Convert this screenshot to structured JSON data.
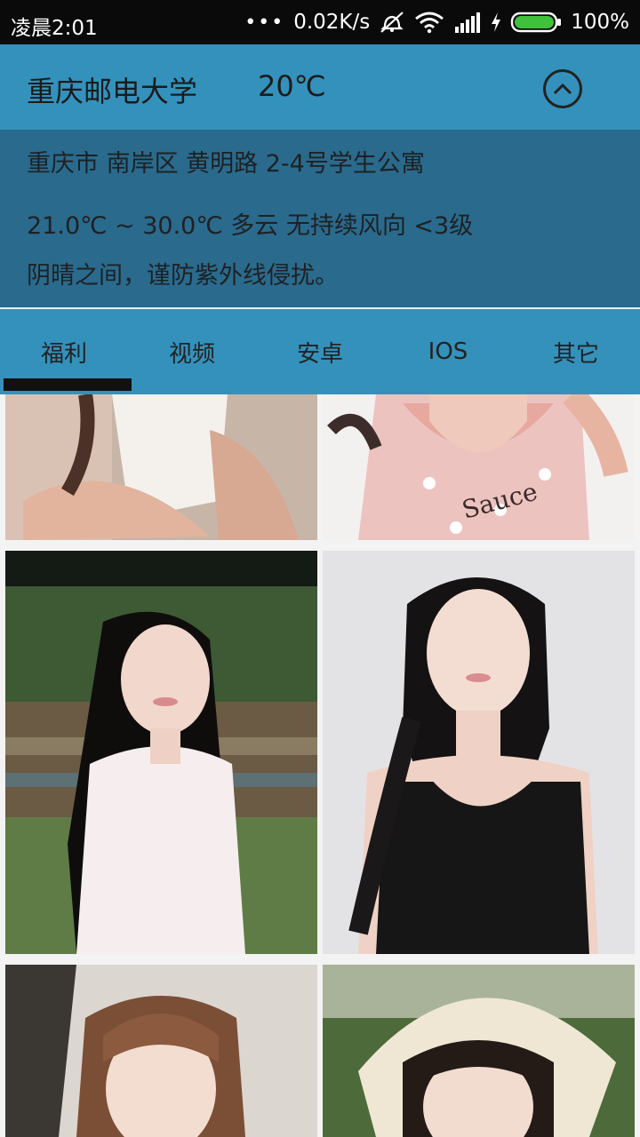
{
  "status_bar": {
    "time": "凌晨2:01",
    "dots": "•••",
    "speed": "0.02K/s",
    "battery": "100%",
    "icons": [
      "alarm-off-icon",
      "wifi-icon",
      "signal-icon",
      "charging-icon",
      "battery-icon"
    ]
  },
  "header": {
    "city": "重庆邮电大学",
    "temperature": "20℃",
    "toggle_icon": "chevron-up-circle-icon"
  },
  "weather": {
    "address": "重庆市 南岸区 黄明路 2-4号学生公寓",
    "forecast": "21.0℃ ~ 30.0℃  多云   无持续风向 <3级",
    "tip": "阴晴之间，谨防紫外线侵扰。"
  },
  "tabs": {
    "items": [
      {
        "label": "福利"
      },
      {
        "label": "视频"
      },
      {
        "label": "安卓"
      },
      {
        "label": "IOS"
      },
      {
        "label": "其它"
      }
    ],
    "active": "福利"
  },
  "colors": {
    "header_bg": "#3491bb",
    "info_bg": "#2a6a8c",
    "indicator": "#111111"
  }
}
